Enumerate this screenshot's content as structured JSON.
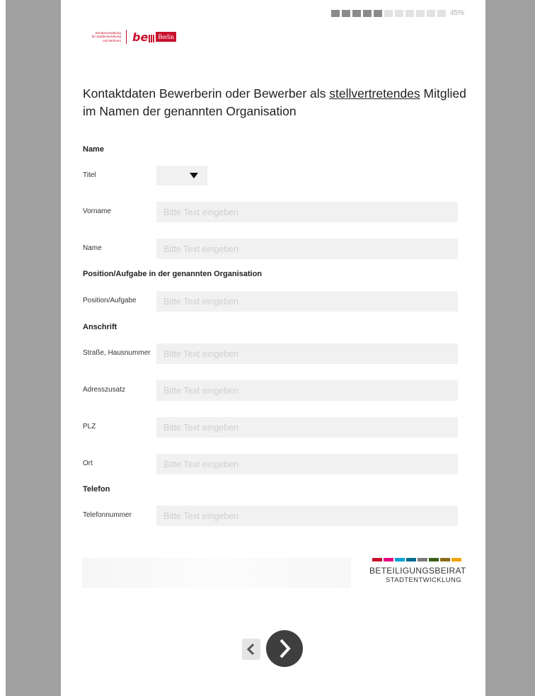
{
  "progress": {
    "percent_label": "45%",
    "filled_segments": 5,
    "total_segments": 11
  },
  "logo": {
    "sen_lines": [
      "Senatsverwaltung",
      "für Stadtentwicklung",
      "und Wohnen"
    ],
    "be": "be",
    "berlin": "Berlin"
  },
  "heading": {
    "part1": "Kontaktdaten Bewerberin oder Bewerber als ",
    "underlined": "stellvertretendes",
    "part2": " Mitglied im Namen der genannten Organisation"
  },
  "form": {
    "placeholder": "Bitte Text eingeben",
    "sections": {
      "name": "Name",
      "position": "Position/Aufgabe in der genannten Organisation",
      "address": "Anschrift",
      "phone": "Telefon"
    },
    "labels": {
      "titel": "Titel",
      "vorname": "Vorname",
      "name": "Name",
      "position": "Position/Aufgabe",
      "strasse": "Straße, Hausnummer",
      "adresszusatz": "Adresszusatz",
      "plz": "PLZ",
      "ort": "Ort",
      "telefonnummer": "Telefonnummer"
    },
    "values": {
      "titel": "",
      "vorname": "",
      "name": "",
      "position": "",
      "strasse": "",
      "adresszusatz": "",
      "plz": "",
      "ort": "",
      "telefonnummer": ""
    }
  },
  "brand": {
    "line1": "BETEILIGUNGSBEIRAT",
    "line2": "STADTENTWICKLUNG",
    "stripe_colors": [
      "#c8102e",
      "#e5007d",
      "#00a0d6",
      "#006d8f",
      "#7b7b7b",
      "#3b5e16",
      "#8a6d1c",
      "#f0a500"
    ]
  },
  "nav": {
    "prev_icon": "chevron-left-icon",
    "next_icon": "chevron-right-icon"
  }
}
